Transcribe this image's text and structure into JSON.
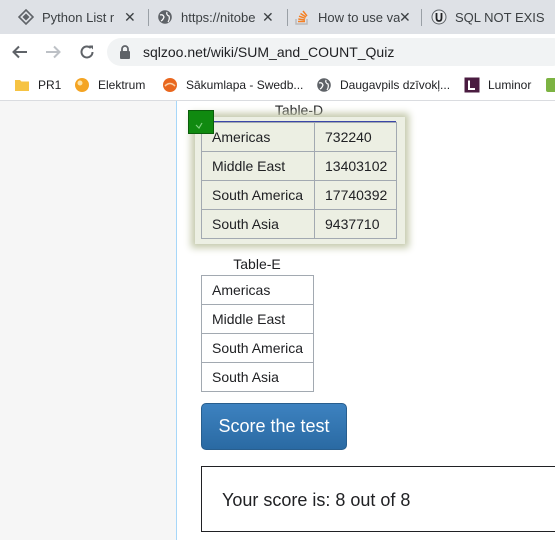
{
  "browser": {
    "tabs": [
      {
        "title": "Python List m",
        "icon": "python-list-favicon"
      },
      {
        "title": "https://nitobe",
        "icon": "globe-icon"
      },
      {
        "title": "How to use va",
        "icon": "stack-overflow-icon"
      },
      {
        "title": "SQL NOT EXIS",
        "icon": "sql-site-favicon"
      }
    ],
    "url": "sqlzoo.net/wiki/SUM_and_COUNT_Quiz",
    "bookmarks": [
      {
        "label": "PR1",
        "icon": "folder-icon",
        "color": "#f6c343"
      },
      {
        "label": "Elektrum",
        "icon": "elektrum-icon",
        "color": "#f4a423"
      },
      {
        "label": "Sākumlapa - Swedb...",
        "icon": "swedbank-icon",
        "color": "#e9671e"
      },
      {
        "label": "Daugavpils dzīvokļ...",
        "icon": "globe-icon",
        "color": "#5f6368"
      },
      {
        "label": "Luminor",
        "icon": "luminor-icon",
        "color": "#4a1c40"
      }
    ]
  },
  "table_d": {
    "caption": "Table-D",
    "rows": [
      [
        "Americas",
        "732240"
      ],
      [
        "Middle East",
        "13403102"
      ],
      [
        "South America",
        "17740392"
      ],
      [
        "South Asia",
        "9437710"
      ]
    ]
  },
  "table_e": {
    "caption": "Table-E",
    "rows": [
      [
        "Americas"
      ],
      [
        "Middle East"
      ],
      [
        "South America"
      ],
      [
        "South Asia"
      ]
    ]
  },
  "score_button": "Score the test",
  "score_text": "Your score is: 8 out of 8",
  "colors": {
    "check_green": "#108a10",
    "button_blue": "#2a6aa3"
  }
}
